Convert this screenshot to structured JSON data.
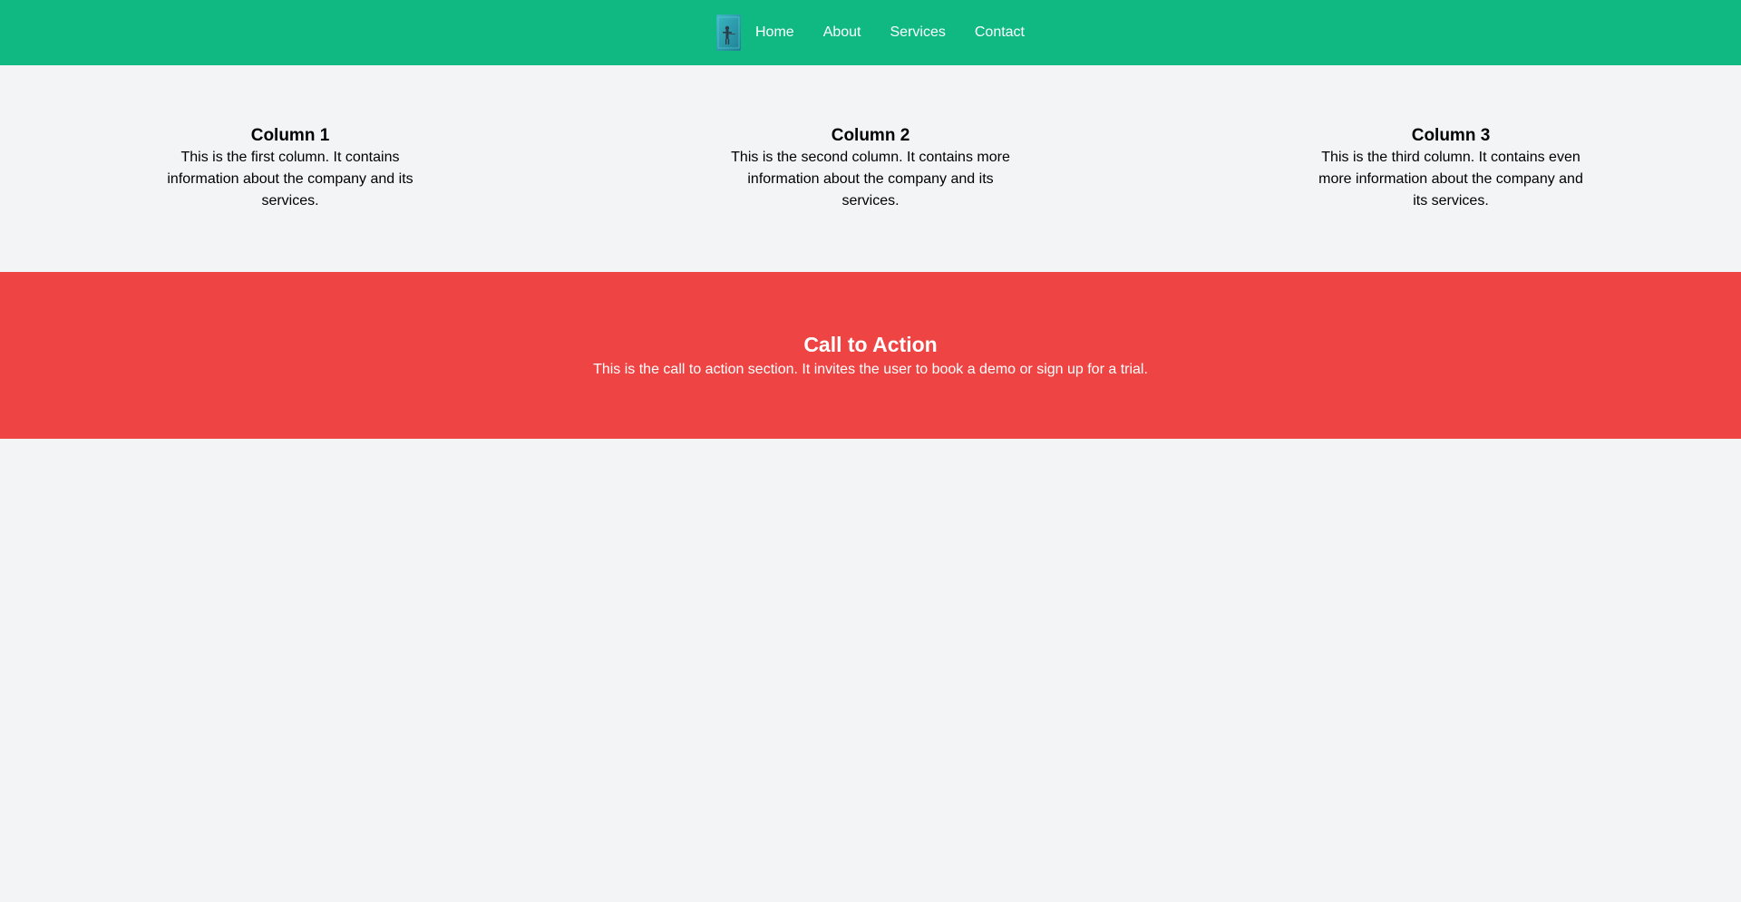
{
  "nav": {
    "logo_icon": "book-cover-logo",
    "links": [
      {
        "label": "Home"
      },
      {
        "label": "About"
      },
      {
        "label": "Services"
      },
      {
        "label": "Contact"
      }
    ]
  },
  "columns": [
    {
      "title": "Column 1",
      "text": "This is the first column. It contains information about the company and its services."
    },
    {
      "title": "Column 2",
      "text": "This is the second column. It contains more information about the company and its services."
    },
    {
      "title": "Column 3",
      "text": "This is the third column. It contains even more information about the company and its services."
    }
  ],
  "cta": {
    "title": "Call to Action",
    "text": "This is the call to action section. It invites the user to book a demo or sign up for a trial."
  },
  "colors": {
    "nav_bg": "#10b981",
    "cta_bg": "#ef4444",
    "page_bg": "#f3f4f6"
  }
}
